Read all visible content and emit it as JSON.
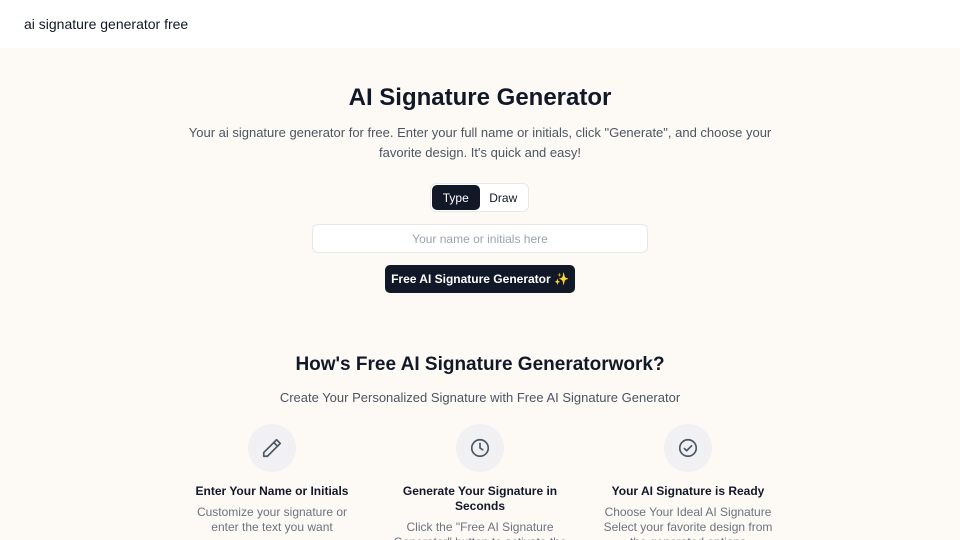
{
  "header": {
    "brand": "ai signature generator free"
  },
  "hero": {
    "title": "AI Signature Generator",
    "subtitle": "Your ai signature generator for free. Enter your full name or initials, click \"Generate\", and choose your favorite design. It's quick and easy!"
  },
  "mode_tabs": [
    {
      "label": "Type",
      "active": true
    },
    {
      "label": "Draw",
      "active": false
    }
  ],
  "input": {
    "placeholder": "Your name or initials here",
    "value": ""
  },
  "generate_button": {
    "label": "Free AI Signature Generator ✨"
  },
  "how": {
    "title": "How's Free AI Signature Generatorwork?",
    "subtitle": "Create Your Personalized Signature with Free AI Signature Generator",
    "steps": [
      {
        "icon": "pencil-icon",
        "title": "Enter Your Name or Initials",
        "description": "Customize your signature or enter the text you want"
      },
      {
        "icon": "clock-icon",
        "title": "Generate Your Signature in Seconds",
        "description": "Click the \"Free AI Signature Generator\" button to activate the AI"
      },
      {
        "icon": "check-circle-icon",
        "title": "Your AI Signature is Ready",
        "description": "Choose Your Ideal AI Signature Select your favorite design from the generated options"
      }
    ]
  },
  "colors": {
    "primary": "#111827",
    "background": "#fdfaf6",
    "muted_text": "#6b7280"
  }
}
